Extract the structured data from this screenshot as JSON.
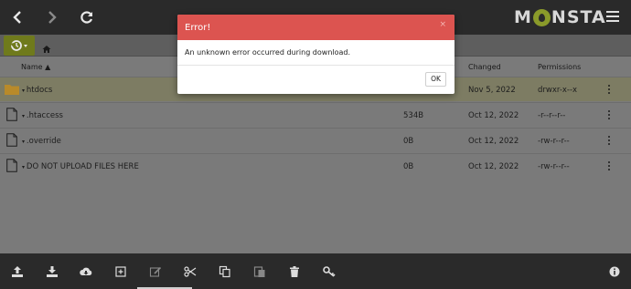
{
  "topbar": {
    "logo_text_left": "M",
    "logo_text_right": "NSTA"
  },
  "table": {
    "columns": {
      "name": "Name ▲",
      "changed": "Changed",
      "permissions": "Permissions"
    },
    "rows": [
      {
        "name": "htdocs",
        "size": "",
        "changed": "Nov 5, 2022",
        "perm": "drwxr-x--x",
        "type": "folder"
      },
      {
        "name": ".htaccess",
        "size": "534B",
        "changed": "Oct 12, 2022",
        "perm": "-r--r--r--",
        "type": "file"
      },
      {
        "name": ".override",
        "size": "0B",
        "changed": "Oct 12, 2022",
        "perm": "-rw-r--r--",
        "type": "file"
      },
      {
        "name": "DO NOT UPLOAD FILES HERE",
        "size": "0B",
        "changed": "Oct 12, 2022",
        "perm": "-rw-r--r--",
        "type": "file"
      }
    ]
  },
  "modal": {
    "title": "Error!",
    "close": "×",
    "message": "An unknown error occurred during download.",
    "ok_label": "OK"
  },
  "colors": {
    "accent": "#6f7a1c",
    "error": "#dc5450",
    "bar": "#2a2a2a"
  },
  "icons": [
    "back-icon",
    "forward-icon",
    "refresh-icon",
    "menu-icon",
    "history-icon",
    "home-icon",
    "upload-icon",
    "download-icon",
    "cloud-download-icon",
    "new-item-icon",
    "edit-icon",
    "cut-icon",
    "copy-icon",
    "paste-icon",
    "trash-icon",
    "key-icon",
    "info-icon"
  ]
}
